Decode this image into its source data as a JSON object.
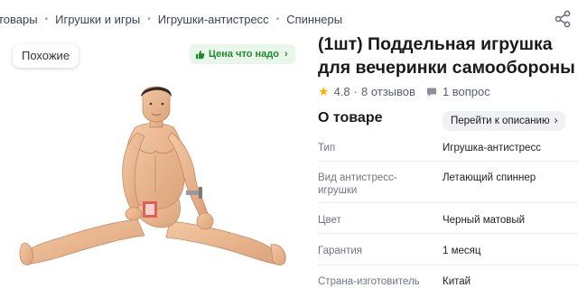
{
  "breadcrumb": [
    "товары",
    "Игрушки и игры",
    "Игрушки-антистресс",
    "Спиннеры"
  ],
  "gallery": {
    "similar_label": "Похожие",
    "price_badge_label": "Цена что надо",
    "image_icon": "action-figure-toy"
  },
  "product": {
    "title": "(1шт) Поддельная игрушка для вечеринки самообороны",
    "rating": "4.8",
    "reviews": "8 отзывов",
    "questions": "1 вопрос"
  },
  "about": {
    "title": "О товаре",
    "to_description_label": "Перейти к описанию",
    "specs": [
      {
        "label": "Тип",
        "value": "Игрушка-антистресс"
      },
      {
        "label": "Вид антистресс-игрушки",
        "value": "Летающий спиннер"
      },
      {
        "label": "Цвет",
        "value": "Черный матовый"
      },
      {
        "label": "Гарантия",
        "value": "1 месяц"
      },
      {
        "label": "Страна-изготовитель",
        "value": "Китай"
      }
    ]
  },
  "colors": {
    "accent_green": "#1d8a2c",
    "star": "#f2b600"
  }
}
